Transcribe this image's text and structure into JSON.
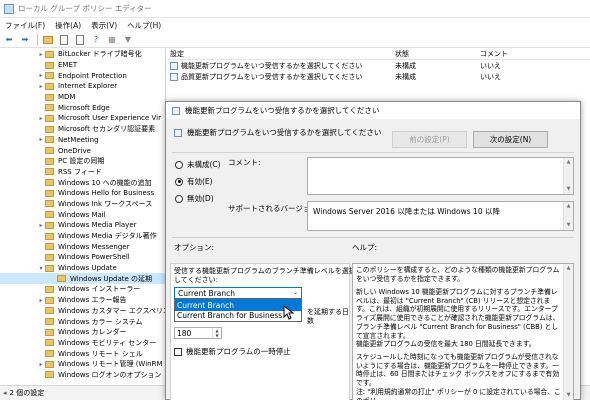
{
  "window": {
    "title": "ローカル グループ ポリシー エディター"
  },
  "menu": [
    "ファイル(F)",
    "操作(A)",
    "表示(V)",
    "ヘルプ(H)"
  ],
  "toolbar": [
    "back-icon",
    "forward-icon",
    "folder-icon",
    "page-icon",
    "page-icon",
    "help-icon",
    "properties-icon",
    "filter-icon"
  ],
  "tree": {
    "items": [
      {
        "label": "BitLocker ドライブ暗号化",
        "expander": "▸"
      },
      {
        "label": "EMET",
        "expander": ""
      },
      {
        "label": "Endpoint Protection",
        "expander": "▸"
      },
      {
        "label": "Internet Explorer",
        "expander": "▸"
      },
      {
        "label": "MDM",
        "expander": ""
      },
      {
        "label": "Microsoft Edge",
        "expander": ""
      },
      {
        "label": "Microsoft User Experience Vir",
        "expander": "▸"
      },
      {
        "label": "Microsoft セカンダリ認証要素",
        "expander": ""
      },
      {
        "label": "NetMeeting",
        "expander": "▸"
      },
      {
        "label": "OneDrive",
        "expander": ""
      },
      {
        "label": "PC 設定の同期",
        "expander": ""
      },
      {
        "label": "RSS フィード",
        "expander": ""
      },
      {
        "label": "Windows 10 への機能の追加",
        "expander": ""
      },
      {
        "label": "Windows Hello for Business",
        "expander": ""
      },
      {
        "label": "Windows Ink ワークスペース",
        "expander": ""
      },
      {
        "label": "Windows Mail",
        "expander": ""
      },
      {
        "label": "Windows Media Player",
        "expander": "▸"
      },
      {
        "label": "Windows Media デジタル著作",
        "expander": ""
      },
      {
        "label": "Windows Messenger",
        "expander": ""
      },
      {
        "label": "Windows PowerShell",
        "expander": ""
      },
      {
        "label": "Windows Update",
        "expander": "▾"
      },
      {
        "label": "Windows Update の延期",
        "expander": "",
        "selected": true,
        "indent": 1
      },
      {
        "label": "Windows インストーラー",
        "expander": ""
      },
      {
        "label": "Windows エラー報告",
        "expander": "▸"
      },
      {
        "label": "Windows カスタマー エクスペリエ",
        "expander": ""
      },
      {
        "label": "Windows カラー システム",
        "expander": ""
      },
      {
        "label": "Windows カレンダー",
        "expander": ""
      },
      {
        "label": "Windows モビリティ センター",
        "expander": ""
      },
      {
        "label": "Windows リモート シェル",
        "expander": ""
      },
      {
        "label": "Windows リモート管理 (WinRM",
        "expander": "▸"
      },
      {
        "label": "Windows ログオンのオプション",
        "expander": ""
      }
    ]
  },
  "list": {
    "headers": {
      "setting": "設定",
      "state": "状態",
      "comment": "コメント"
    },
    "rows": [
      {
        "setting": "機能更新プログラムをいつ受信するかを選択してください",
        "state": "未構成",
        "comment": "いいえ"
      },
      {
        "setting": "品質更新プログラムをいつ受信するかを選択してください",
        "state": "未構成",
        "comment": "いいえ"
      }
    ]
  },
  "status": {
    "text": "2 個の設定"
  },
  "dialog": {
    "title": "機能更新プログラムをいつ受信するかを選択してください",
    "subtitle": "機能更新プログラムをいつ受信するかを選択してください",
    "prev_button": "前の設定(P)",
    "next_button": "次の設定(N)",
    "radio_not_configured": "未構成(C)",
    "radio_enabled": "有効(E)",
    "radio_disabled": "無効(D)",
    "selected_radio": "enabled",
    "comment_label": "コメント:",
    "supported_label": "サポートされるバージョン:",
    "supported_value": "Windows Server 2016 以降または Windows 10 以降",
    "options_label": "オプション:",
    "help_label": "ヘルプ:",
    "branch_prompt_line1": "受信する機能更新プログラムのブランチ準備レベルを選択",
    "branch_prompt_line2": "してください:",
    "branch_selected": "Current Branch",
    "branch_options": [
      "Current Branch",
      "Current Branch for Business"
    ],
    "defer_label": "を延期する日",
    "defer_label2": "数",
    "defer_value": "180",
    "pause_label": "機能更新プログラムの一時停止",
    "help_paragraphs": [
      "このポリシーを構成すると、どのような種類の機能更新プログラムをいつ受信するかを指定できます。",
      "新しい Windows 10 機能更新プログラムに対するブランチ準備レベルは、最初は \"Current Branch\" (CB) リリースと想定されます。これは、組織が初期展開に使用するリリースです。エンタープライズ展開に使用できることが確認された機能更新プログラムは、ブランチ準備レベル \"Current Branch for Business\" (CBB) として宣言されます。",
      "機能更新プログラムの受信を最大 180 日間延長できます。",
      "スケジュールした時刻になっても機能更新プログラムが受信されないようにする場合は、機能更新プログラムを一時停止できます。一時停止は、60 日間またはチェック ボックスをオフにするまで有効です。",
      "注: \"利用規約通常の打止\" ポリシーが 0 に設定されている場合、このポリ"
    ]
  }
}
